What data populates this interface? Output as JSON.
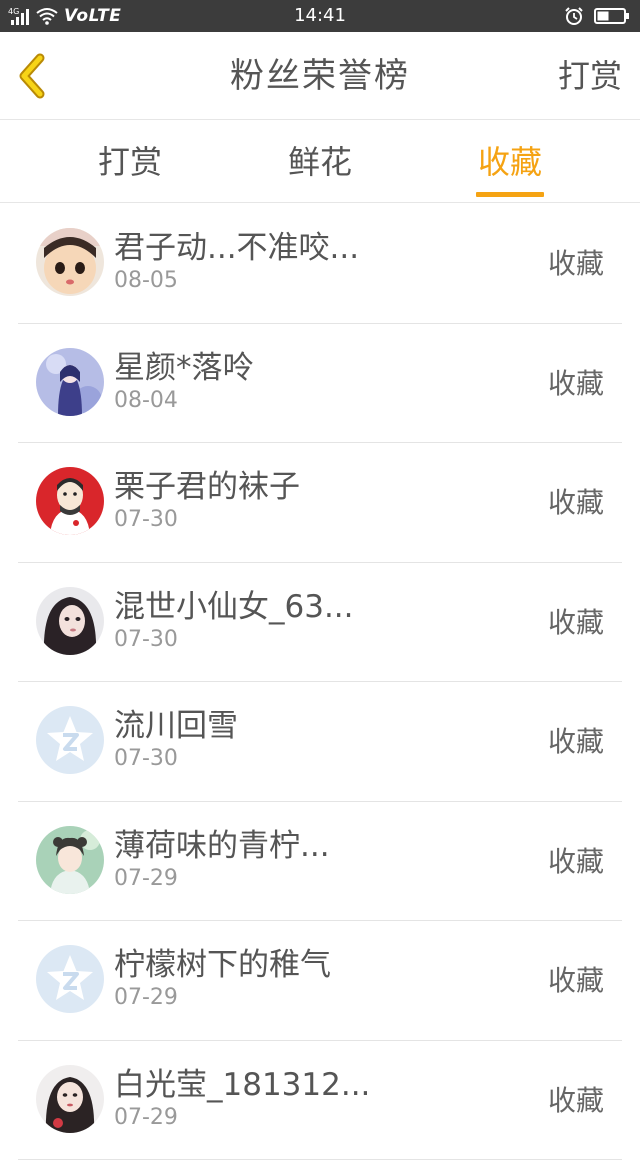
{
  "status_bar": {
    "network": "4G",
    "carrier_mode": "VoLTE",
    "time": "14:41"
  },
  "header": {
    "title": "粉丝荣誉榜",
    "action_label": "打赏",
    "back_icon": "chevron-left-icon",
    "accent_color": "#f5a313"
  },
  "tabs": [
    {
      "label": "打赏",
      "active": false
    },
    {
      "label": "鲜花",
      "active": false
    },
    {
      "label": "收藏",
      "active": true
    }
  ],
  "fans": [
    {
      "name": "君子动...不准咬...",
      "date": "08-05",
      "action": "收藏",
      "avatar": "doll-avatar"
    },
    {
      "name": "星颜*落呤",
      "date": "08-04",
      "action": "收藏",
      "avatar": "anime-girl-avatar"
    },
    {
      "name": "栗子君的袜子",
      "date": "07-30",
      "action": "收藏",
      "avatar": "cartoon-man-avatar"
    },
    {
      "name": "混世小仙女_63...",
      "date": "07-30",
      "action": "收藏",
      "avatar": "girl-portrait-avatar"
    },
    {
      "name": "流川回雪",
      "date": "07-30",
      "action": "收藏",
      "avatar": "default-star-avatar"
    },
    {
      "name": "薄荷味的青柠...",
      "date": "07-29",
      "action": "收藏",
      "avatar": "anime-boy-avatar"
    },
    {
      "name": "柠檬树下的稚气",
      "date": "07-29",
      "action": "收藏",
      "avatar": "default-star-avatar"
    },
    {
      "name": "白光莹_181312...",
      "date": "07-29",
      "action": "收藏",
      "avatar": "woman-portrait-avatar"
    }
  ]
}
